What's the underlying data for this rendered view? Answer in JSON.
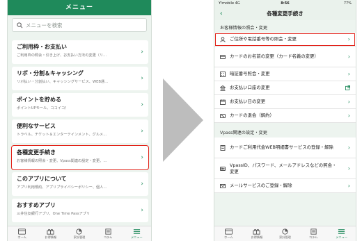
{
  "left": {
    "header_title": "メニュー",
    "search_placeholder": "メニューを検索",
    "cards": [
      {
        "title": "ご利用枠・お支払い",
        "sub": "ご利用枠の照会・引き上げ、お支払い方法の変更（リ…"
      },
      {
        "title": "リボ・分割＆キャッシング",
        "sub": "リボ払い・分割払い、キャッシングサービス、WEB通…"
      },
      {
        "title": "ポイントを貯める",
        "sub": "ポイントUPモール、ココイコ！"
      },
      {
        "title": "便利なサービス",
        "sub": "トラベル、チケット＆エンターテインメント、グルメ…"
      },
      {
        "title": "各種変更手続き",
        "sub": "お客様情報の照会・変更、Vpass関連の設定・変更、…"
      },
      {
        "title": "このアプリについて",
        "sub": "アプリ利用規約、アプリプライバシーポリシー、個人…"
      },
      {
        "title": "おすすめアプリ",
        "sub": "三井住友銀行アプリ、One Time Passアプリ"
      }
    ],
    "tabs": [
      {
        "label": "ホーム"
      },
      {
        "label": "お得情報"
      },
      {
        "label": "家計管理"
      },
      {
        "label": "コラム"
      },
      {
        "label": "メニュー"
      }
    ]
  },
  "right": {
    "status": {
      "carrier": "Y!mobile  4G",
      "time": "8:56",
      "battery": "77%"
    },
    "header_title": "各種変更手続き",
    "section1": "お客様情報の照会・変更",
    "items1": [
      {
        "label": "ご住所や電話番号等の照会・変更"
      },
      {
        "label": "カードのお名前の変更（カード名義の変更）"
      },
      {
        "label": "暗証番号照会・変更"
      },
      {
        "label": "お支払い口座の変更"
      },
      {
        "label": "お支払い日の変更"
      },
      {
        "label": "カードの退会（解約）"
      }
    ],
    "section2": "Vpass関連の設定・変更",
    "items2": [
      {
        "label": "カードご利用代金WEB明細書サービスの登録・解除"
      },
      {
        "label": "VpassID、パスワード、メールアドレスなどの照会・変更"
      },
      {
        "label": "メールサービスのご登録・解除"
      }
    ],
    "tabs": [
      {
        "label": "ホーム"
      },
      {
        "label": "お得情報"
      },
      {
        "label": "家計管理"
      },
      {
        "label": "コラム"
      },
      {
        "label": "メニュー"
      }
    ]
  },
  "colors": {
    "brand": "#1f8a5b",
    "highlight": "#e2231a",
    "arrow": "#bdbdbd"
  }
}
